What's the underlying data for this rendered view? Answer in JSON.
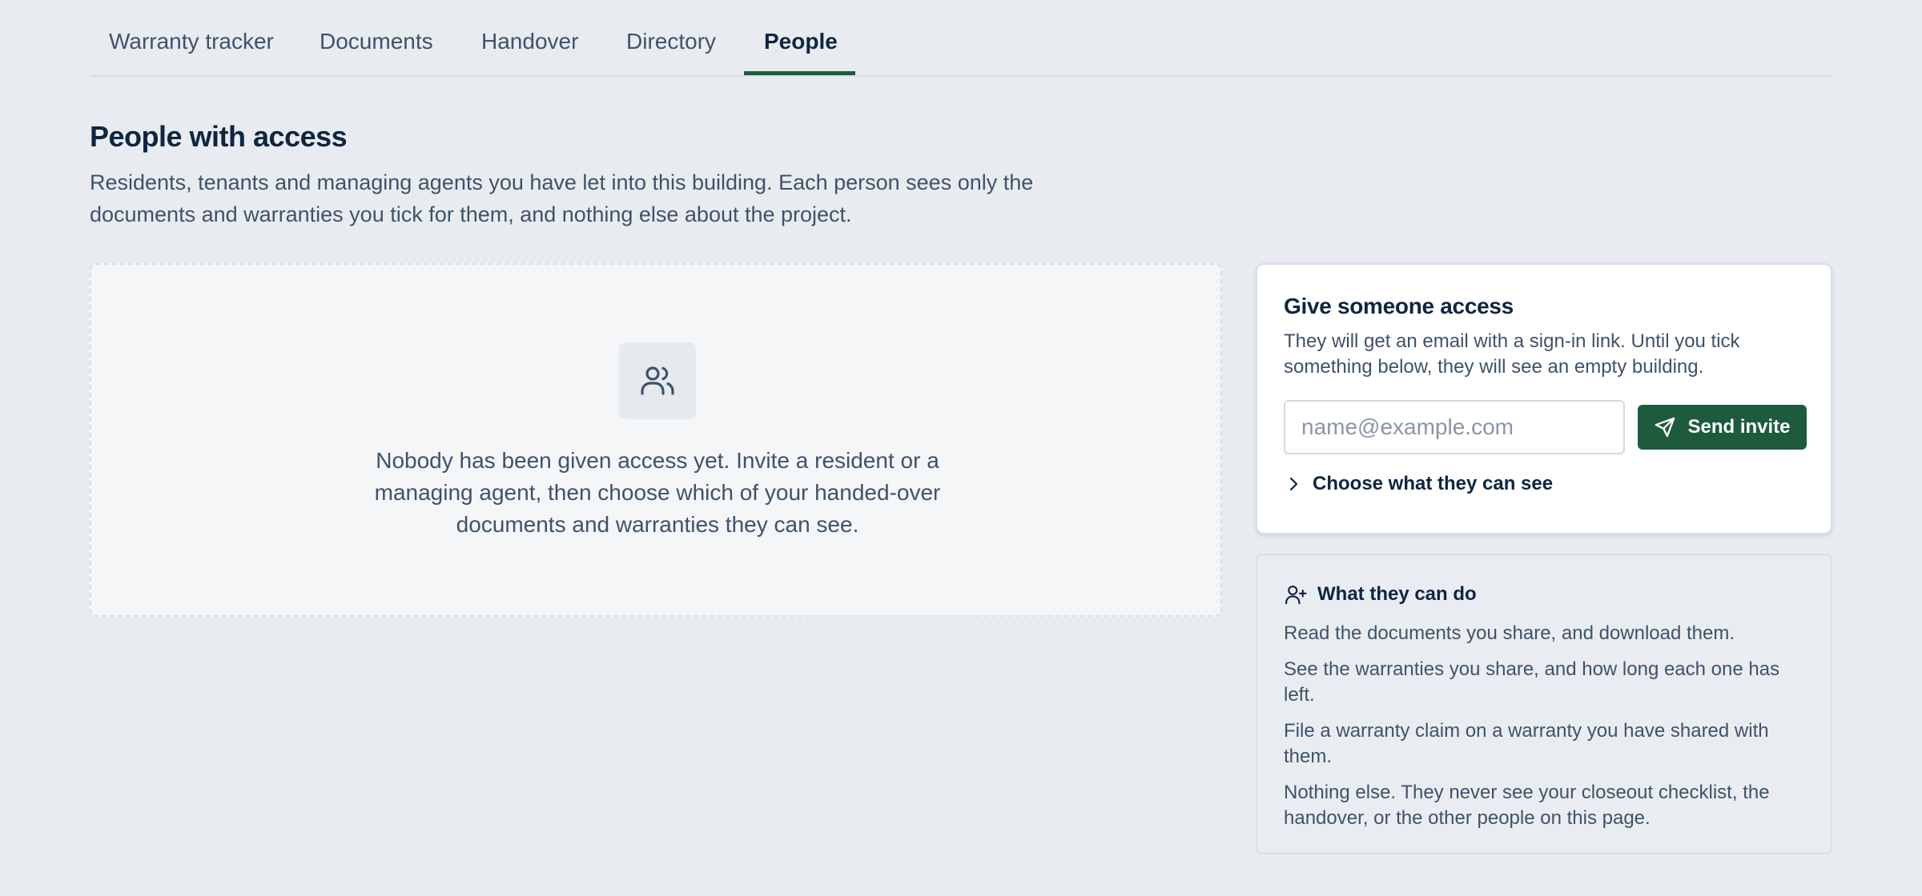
{
  "tabs": [
    {
      "label": "Warranty tracker"
    },
    {
      "label": "Documents"
    },
    {
      "label": "Handover"
    },
    {
      "label": "Directory"
    },
    {
      "label": "People",
      "active": true
    }
  ],
  "header": {
    "title": "People with access",
    "description": "Residents, tenants and managing agents you have let into this building. Each person sees only the documents and warranties you tick for them, and nothing else about the project."
  },
  "empty_state": {
    "icon": "users-icon",
    "message": "Nobody has been given access yet. Invite a resident or a managing agent, then choose which of your handed-over documents and warranties they can see."
  },
  "invite": {
    "title": "Give someone access",
    "description": "They will get an email with a sign-in link. Until you tick something below, they will see an empty building.",
    "email_placeholder": "name@example.com",
    "email_value": "",
    "send_label": "Send invite",
    "send_icon": "send-icon",
    "choose_label": "Choose what they can see",
    "choose_icon": "chevron-right-icon"
  },
  "permissions": {
    "icon": "user-plus-icon",
    "title": "What they can do",
    "items": [
      "Read the documents you share, and download them.",
      "See the warranties you share, and how long each one has left.",
      "File a warranty claim on a warranty you have shared with them.",
      "Nothing else. They never see your closeout checklist, the handover, or the other people on this page."
    ]
  },
  "colors": {
    "background": "#e8ecf1",
    "accent": "#1d5b3c",
    "text_primary": "#0f2540",
    "text_secondary": "#3f5269"
  }
}
